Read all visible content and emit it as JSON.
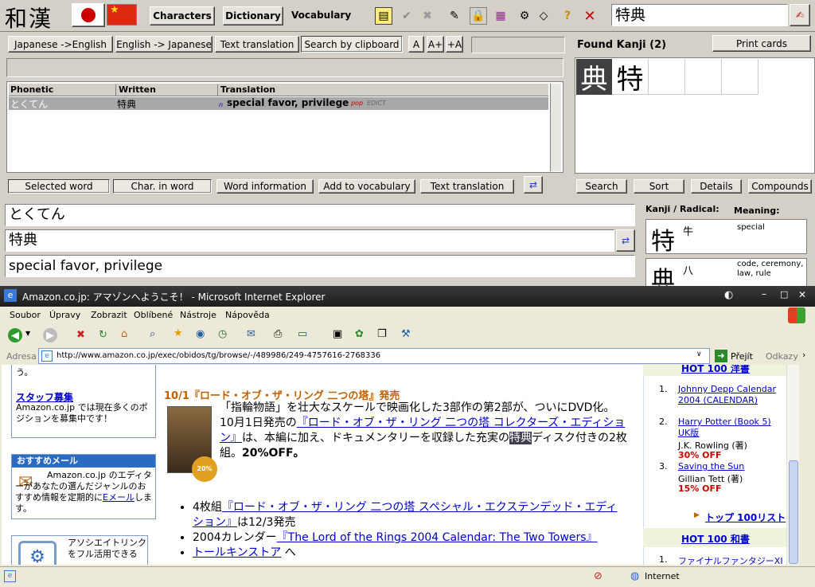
{
  "app": {
    "logo": "和漢",
    "main_tabs": [
      "Characters",
      "Dictionary",
      "Vocabulary"
    ],
    "search_value": "特典"
  },
  "toolbar2": {
    "buttons": [
      "Japanese ->English",
      "English -> Japanese",
      "Text translation",
      "Search by clipboard",
      "A",
      "A+",
      "+A"
    ]
  },
  "results": {
    "headers": [
      "Phonetic",
      "Written",
      "Translation"
    ],
    "rows": [
      {
        "phonetic": "とくてん",
        "written": "特典",
        "pos": "n",
        "translation": "special favor, privilege",
        "tag": "pop",
        "source": "EDICT"
      }
    ]
  },
  "bottom_buttons": [
    "Selected word",
    "Char. in word",
    "Word information",
    "Add to vocabulary",
    "Text translation"
  ],
  "kanji_panel": {
    "title": "Found Kanji (2)",
    "print_label": "Print cards",
    "kanji": [
      "典",
      "特"
    ],
    "buttons": [
      "Search",
      "Sort",
      "Details",
      "Compounds"
    ]
  },
  "word_fields": {
    "reading": "とくてん",
    "written": "特典",
    "meaning": "special favor, privilege"
  },
  "radical_panel": {
    "header_kanji": "Kanji / Radical:",
    "header_meaning": "Meaning:",
    "entries": [
      {
        "kanji": "特",
        "radical": "牛",
        "meaning": "special"
      },
      {
        "kanji": "典",
        "radical": "八",
        "meaning": "code, ceremony, law, rule"
      }
    ]
  },
  "ie": {
    "title": "Amazon.co.jp: アマゾンへようこそ！ - Microsoft Internet Explorer",
    "menus": [
      "Soubor",
      "Úpravy",
      "Zobrazit",
      "Oblíbené",
      "Nástroje",
      "Nápověda"
    ],
    "address_label": "Adresa",
    "url": "http://www.amazon.co.jp/exec/obidos/tg/browse/-/489986/249-4757616-2768336",
    "go_label": "Přejít",
    "links_label": "Odkazy",
    "status_zone": "Internet"
  },
  "page": {
    "left_top_text": "う。",
    "staff_link": "スタッフ募集",
    "staff_text": "Amazon.co.jp では現在多くのポジションを募集中です！",
    "mail_header": "おすすめメール",
    "mail_text_1": "Amazon.co.jp のエディターがあなたの選んだジャンルのおすすめ情報を定期的に",
    "mail_link": "Eメール",
    "mail_text_2": "します。",
    "assoc_text": "アソシエイトリンクをフル活用できる",
    "headline": "10/1『ロード・オブ・ザ・リング 二つの塔』発売",
    "poster_badge": "20% off",
    "body_1": "「指輪物語」を壮大なスケールで映画化した3部作の第2部が、ついにDVD化。",
    "body_2": "10月1日発売の",
    "body_link": "『ロード・オブ・ザ・リング 二つの塔 コレクターズ・エディション』",
    "body_3": "は、本編に加え、ドキュメンタリーを収録した充実の",
    "body_highlight": "特典",
    "body_4": "ディスク付きの2枚組。",
    "body_off": "20%OFF。",
    "bullets": [
      {
        "prefix": "4枚組",
        "link": "『ロード・オブ・ザ・リング 二つの塔 スペシャル・エクステンデッド・エディション』",
        "suffix": "は12/3発売"
      },
      {
        "prefix": "2004カレンダー",
        "link": "『The Lord of the Rings 2004 Calendar: The Two Towers』",
        "suffix": ""
      },
      {
        "prefix": "",
        "link": "トールキンストア",
        "suffix": " へ"
      }
    ],
    "right_header_1": "HOT 100 洋書",
    "right_items": [
      {
        "num": "1.",
        "title": "Johnny Depp Calendar 2004 (CALENDAR)",
        "author": "",
        "off": ""
      },
      {
        "num": "2.",
        "title": "Harry Potter (Book 5) UK版",
        "author": "J.K. Rowling (著)",
        "off": "30% OFF"
      },
      {
        "num": "3.",
        "title": "Saving the Sun",
        "author": "Gillian Tett (著)",
        "off": "15% OFF"
      }
    ],
    "top100_link": "トップ 100リスト",
    "right_header_2": "HOT 100 和書",
    "right_item_last": "ファイナルファンタジーXI"
  }
}
